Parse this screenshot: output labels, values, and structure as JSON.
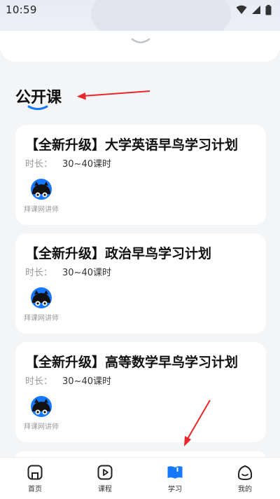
{
  "status_bar": {
    "time": "10:59"
  },
  "section": {
    "title": "公开课"
  },
  "courses": [
    {
      "title": "【全新升级】大学英语早鸟学习计划",
      "duration_label": "时长：",
      "duration_value": "30~40课时",
      "teacher": "拜课网讲师"
    },
    {
      "title": "【全新升级】政治早鸟学习计划",
      "duration_label": "时长：",
      "duration_value": "30~40课时",
      "teacher": "拜课网讲师"
    },
    {
      "title": "【全新升级】高等数学早鸟学习计划",
      "duration_label": "时长：",
      "duration_value": "30~40课时",
      "teacher": "拜课网讲师"
    }
  ],
  "tabbar": {
    "items": [
      {
        "label": "首页",
        "icon": "home-icon"
      },
      {
        "label": "课程",
        "icon": "play-icon"
      },
      {
        "label": "学习",
        "icon": "book-icon",
        "active": true
      },
      {
        "label": "我的",
        "icon": "profile-face-icon"
      }
    ]
  },
  "colors": {
    "accent": "#1677ff",
    "annotation": "#e8262b",
    "background": "#f4f5f7"
  }
}
